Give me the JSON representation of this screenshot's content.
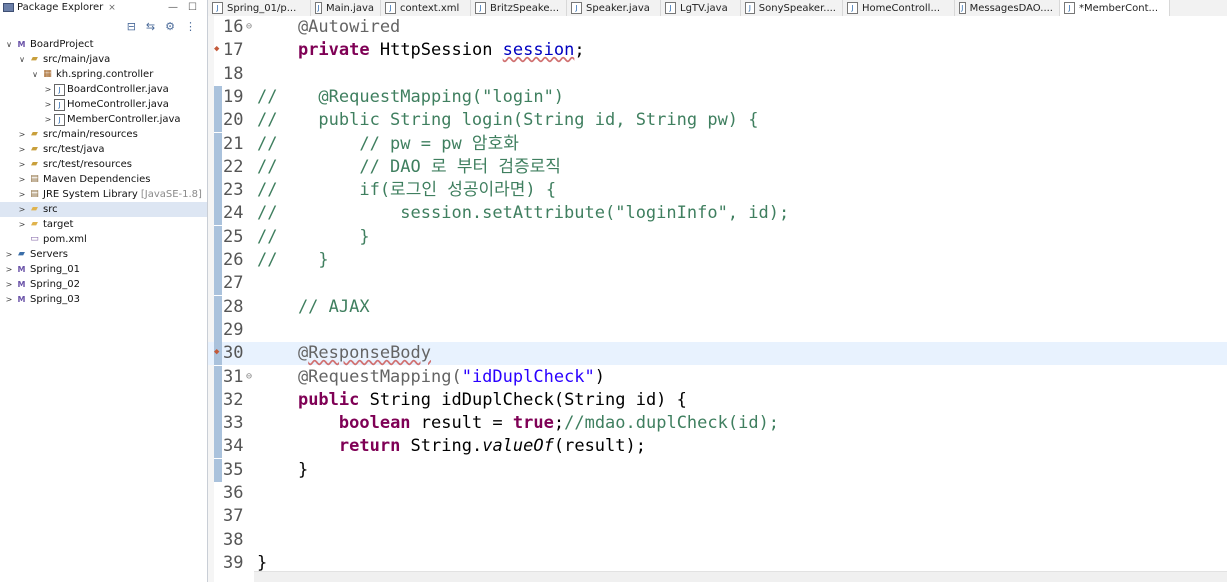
{
  "explorer": {
    "title": "Package Explorer",
    "close": "⨯",
    "min": "—",
    "max": "☐",
    "tree": [
      {
        "label": "BoardProject",
        "icon": "project-icon",
        "tw": "∨",
        "indent": 0
      },
      {
        "label": "src/main/java",
        "icon": "source-folder-icon",
        "tw": "∨",
        "indent": 1
      },
      {
        "label": "kh.spring.controller",
        "icon": "package-icon",
        "tw": "∨",
        "indent": 2
      },
      {
        "label": "BoardController.java",
        "icon": "java-file-icon",
        "tw": ">",
        "indent": 3
      },
      {
        "label": "HomeController.java",
        "icon": "java-file-icon",
        "tw": ">",
        "indent": 3
      },
      {
        "label": "MemberController.java",
        "icon": "java-file-icon",
        "tw": ">",
        "indent": 3
      },
      {
        "label": "src/main/resources",
        "icon": "source-folder-icon",
        "tw": ">",
        "indent": 1
      },
      {
        "label": "src/test/java",
        "icon": "source-folder-icon",
        "tw": ">",
        "indent": 1
      },
      {
        "label": "src/test/resources",
        "icon": "source-folder-icon",
        "tw": ">",
        "indent": 1
      },
      {
        "label": "Maven Dependencies",
        "icon": "library-icon",
        "tw": ">",
        "indent": 1
      },
      {
        "label": "JRE System Library",
        "icon": "library-icon",
        "tw": ">",
        "indent": 1,
        "extra": "[JavaSE-1.8]"
      },
      {
        "label": "src",
        "icon": "folder-icon",
        "tw": ">",
        "indent": 1,
        "selected": true
      },
      {
        "label": "target",
        "icon": "folder-icon",
        "tw": ">",
        "indent": 1
      },
      {
        "label": "pom.xml",
        "icon": "xml-file-icon",
        "tw": "",
        "indent": 1
      },
      {
        "label": "Servers",
        "icon": "servers-icon",
        "tw": ">",
        "indent": 0
      },
      {
        "label": "Spring_01",
        "icon": "project-icon",
        "tw": ">",
        "indent": 0
      },
      {
        "label": "Spring_02",
        "icon": "project-icon",
        "tw": ">",
        "indent": 0
      },
      {
        "label": "Spring_03",
        "icon": "project-icon",
        "tw": ">",
        "indent": 0
      }
    ]
  },
  "tabs": [
    {
      "label": "Spring_01/p...",
      "width": 103
    },
    {
      "label": "Main.java",
      "width": 70
    },
    {
      "label": "context.xml",
      "width": 90
    },
    {
      "label": "BritzSpeake...",
      "width": 96
    },
    {
      "label": "Speaker.java",
      "width": 94
    },
    {
      "label": "LgTV.java",
      "width": 80
    },
    {
      "label": "SonySpeaker....",
      "width": 102
    },
    {
      "label": "HomeControll...",
      "width": 112
    },
    {
      "label": "MessagesDAO....",
      "width": 105
    },
    {
      "label": "*MemberCont...",
      "width": 110,
      "active": true
    }
  ],
  "editor": {
    "lines": [
      {
        "n": "16",
        "fold": true,
        "tokens": [
          [
            "an",
            "    @Autowired"
          ]
        ]
      },
      {
        "n": "17",
        "bp": true,
        "tokens": [
          [
            "",
            "    "
          ],
          [
            "kw",
            "private"
          ],
          [
            "",
            " HttpSession "
          ],
          [
            "fld squig",
            "session"
          ],
          [
            "",
            ";"
          ]
        ]
      },
      {
        "n": "18",
        "tokens": []
      },
      {
        "n": "19",
        "chg": true,
        "tokens": [
          [
            "cm",
            "//    @RequestMapping(\"login\")"
          ]
        ]
      },
      {
        "n": "20",
        "chg": true,
        "tokens": [
          [
            "cm",
            "//    public String login(String id, String pw) {"
          ]
        ]
      },
      {
        "n": "21",
        "chg": true,
        "tokens": [
          [
            "cm",
            "//        // pw = pw 암호화"
          ]
        ]
      },
      {
        "n": "22",
        "chg": true,
        "tokens": [
          [
            "cm",
            "//        // DAO 로 부터 검증로직"
          ]
        ]
      },
      {
        "n": "23",
        "chg": true,
        "tokens": [
          [
            "cm",
            "//        if(로그인 성공이라면) {"
          ]
        ]
      },
      {
        "n": "24",
        "chg": true,
        "tokens": [
          [
            "cm",
            "//            session.setAttribute(\"loginInfo\", id);"
          ]
        ]
      },
      {
        "n": "25",
        "chg": true,
        "tokens": [
          [
            "cm",
            "//        }"
          ]
        ]
      },
      {
        "n": "26",
        "chg": true,
        "tokens": [
          [
            "cm",
            "//    }"
          ]
        ]
      },
      {
        "n": "27",
        "chg": true,
        "tokens": []
      },
      {
        "n": "28",
        "chg": true,
        "tokens": [
          [
            "cm",
            "    // AJAX"
          ]
        ]
      },
      {
        "n": "29",
        "chg": true,
        "tokens": []
      },
      {
        "n": "30",
        "chg": true,
        "bp": true,
        "hl": true,
        "tokens": [
          [
            "an",
            "    @"
          ],
          [
            "an squig",
            "ResponseBody"
          ]
        ]
      },
      {
        "n": "31",
        "chg": true,
        "fold": true,
        "tokens": [
          [
            "an",
            "    @RequestMapping("
          ],
          [
            "str",
            "\"idDuplCheck\""
          ],
          [
            "",
            ")"
          ]
        ]
      },
      {
        "n": "32",
        "chg": true,
        "tokens": [
          [
            "",
            "    "
          ],
          [
            "kw",
            "public"
          ],
          [
            "",
            " String idDuplCheck(String id) {"
          ]
        ]
      },
      {
        "n": "33",
        "chg": true,
        "tokens": [
          [
            "",
            "        "
          ],
          [
            "kw",
            "boolean"
          ],
          [
            "",
            " result = "
          ],
          [
            "kw",
            "true"
          ],
          [
            "",
            ";"
          ],
          [
            "cm",
            "//mdao.duplCheck(id);"
          ]
        ]
      },
      {
        "n": "34",
        "chg": true,
        "tokens": [
          [
            "",
            "        "
          ],
          [
            "kw",
            "return"
          ],
          [
            "",
            " String."
          ],
          [
            "it",
            "valueOf"
          ],
          [
            "",
            "(result);"
          ]
        ]
      },
      {
        "n": "35",
        "chg": true,
        "tokens": [
          [
            "",
            "    }"
          ]
        ]
      },
      {
        "n": "36",
        "tokens": []
      },
      {
        "n": "37",
        "tokens": []
      },
      {
        "n": "38",
        "tokens": []
      },
      {
        "n": "39",
        "tokens": [
          [
            "",
            "}"
          ]
        ]
      }
    ]
  }
}
